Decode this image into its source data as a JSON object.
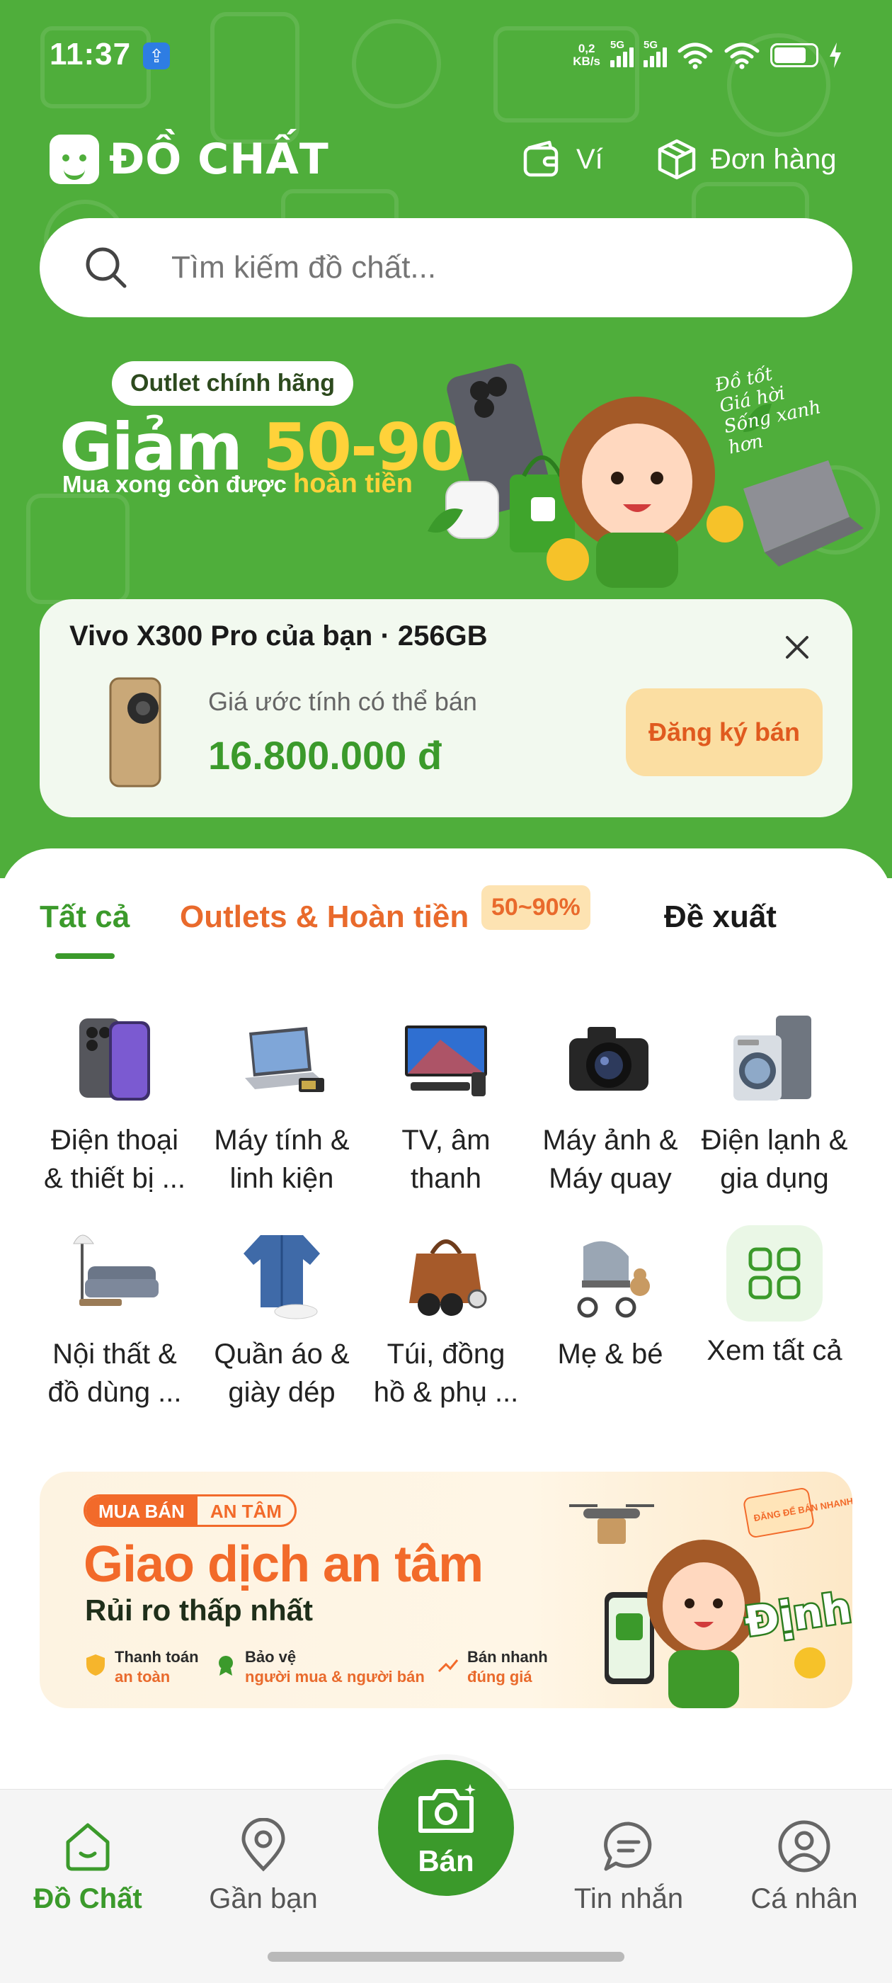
{
  "status_bar": {
    "time": "11:37",
    "usb_icon": "usb-icon",
    "net_speed_value": "0,2",
    "net_speed_unit": "KB/s",
    "signal_1_label": "5G",
    "signal_2_label": "5G"
  },
  "header": {
    "brand": "ĐỒ CHẤT",
    "wallet_label": "Ví",
    "orders_label": "Đơn hàng"
  },
  "search": {
    "placeholder": "Tìm kiếm đồ chất..."
  },
  "promo_banner": {
    "tag": "Outlet chính hãng",
    "headline_prefix": "Giảm ",
    "headline_highlight": "50-90%",
    "subline_prefix": "Mua xong còn được ",
    "subline_highlight": "hoàn tiền",
    "slogan_1": "Đồ tốt",
    "slogan_2": "Giá hời",
    "slogan_3": "Sống xanh hơn"
  },
  "sell_card": {
    "title": "Vivo X300 Pro của bạn · 256GB",
    "price_label": "Giá ước tính có thể bán",
    "price": "16.800.000 đ",
    "button": "Đăng ký bán"
  },
  "tabs": {
    "all": "Tất cả",
    "outlet": "Outlets & Hoàn tiền",
    "outlet_badge": "50~90%",
    "suggest": "Đề xuất"
  },
  "categories": [
    {
      "line1": "Điện thoại",
      "line2": "& thiết bị ...",
      "icon": "smartphone-icon"
    },
    {
      "line1": "Máy tính &",
      "line2": "linh kiện",
      "icon": "laptop-icon"
    },
    {
      "line1": "TV, âm",
      "line2": "thanh",
      "icon": "tv-icon"
    },
    {
      "line1": "Máy ảnh &",
      "line2": "Máy quay",
      "icon": "camera-icon"
    },
    {
      "line1": "Điện lạnh &",
      "line2": "gia dụng",
      "icon": "washing-machine-icon"
    },
    {
      "line1": "Nội thất &",
      "line2": "đồ dùng ...",
      "icon": "sofa-icon"
    },
    {
      "line1": "Quần áo &",
      "line2": "giày dép",
      "icon": "jacket-icon"
    },
    {
      "line1": "Túi, đồng",
      "line2": "hồ & phụ ...",
      "icon": "handbag-icon"
    },
    {
      "line1": "Mẹ & bé",
      "line2": "",
      "icon": "stroller-icon"
    },
    {
      "line1": "Xem tất cả",
      "line2": "",
      "icon": "grid-icon"
    }
  ],
  "safe_banner": {
    "tag_left": "MUA BÁN",
    "tag_right": "AN TÂM",
    "title": "Giao dịch an tâm",
    "subtitle": "Rủi ro thấp nhất",
    "feature_1_title": "Thanh toán",
    "feature_1_sub": "an toàn",
    "feature_2_title": "Bảo vệ",
    "feature_2_sub": "người mua & người bán",
    "feature_3_title": "Bán nhanh",
    "feature_3_sub": "đúng giá",
    "sticker": "ĐĂNG ĐỂ BÁN NHANH!",
    "valuation": "Định giá"
  },
  "bottom_nav": {
    "home": "Đồ Chất",
    "nearby": "Gần bạn",
    "sell": "Bán",
    "messages": "Tin nhắn",
    "profile": "Cá nhân"
  },
  "colors": {
    "brand_green": "#4fae3b",
    "accent_green": "#3b9a2b",
    "accent_orange": "#e96a2c",
    "promo_yellow": "#ffd23a"
  }
}
